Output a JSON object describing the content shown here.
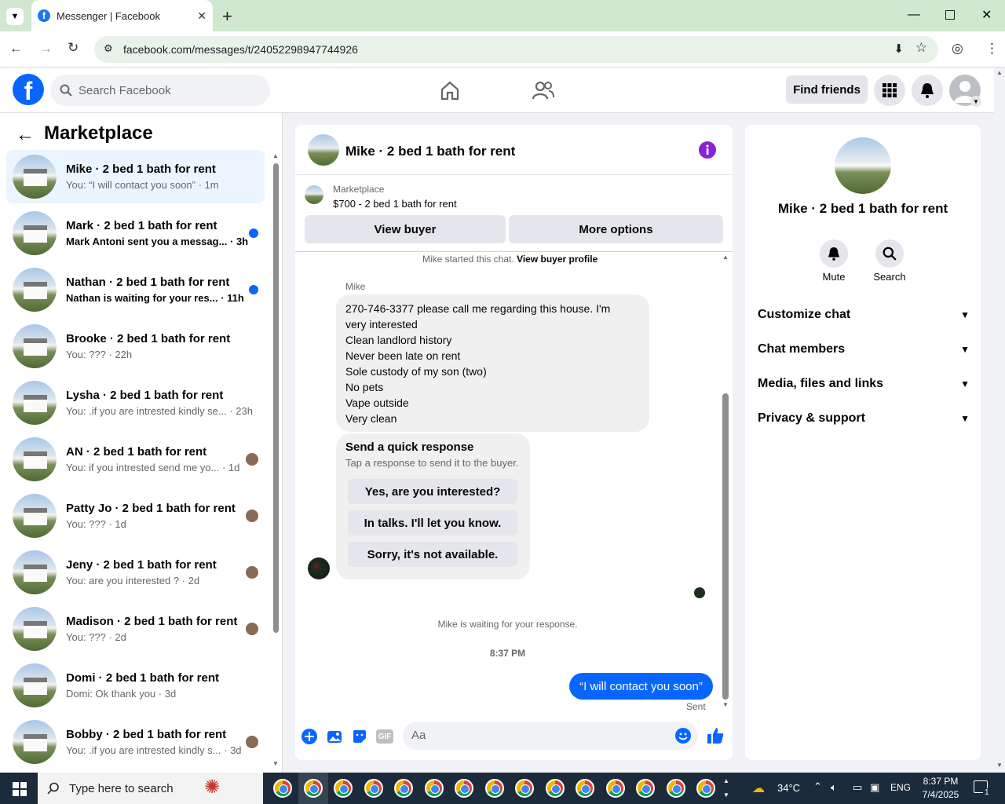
{
  "browser": {
    "tab_title": "Messenger | Facebook",
    "url": "facebook.com/messages/t/24052298947744926"
  },
  "fb": {
    "search_placeholder": "Search Facebook",
    "find_friends": "Find friends"
  },
  "left": {
    "title": "Marketplace",
    "conversations": [
      {
        "name": "Mike · 2 bed 1 bath for rent",
        "preview": "You: “I will contact you soon” · 1m",
        "indicator": "none"
      },
      {
        "name": "Mark · 2 bed 1 bath for rent",
        "preview": "Mark Antoni sent you a messag... · 3h",
        "indicator": "unread"
      },
      {
        "name": "Nathan · 2 bed 1 bath for rent",
        "preview": "Nathan is waiting for your res... · 11h",
        "indicator": "unread"
      },
      {
        "name": "Brooke · 2 bed 1 bath for rent",
        "preview": "You: ??? · 22h",
        "indicator": "none"
      },
      {
        "name": "Lysha · 2 bed 1 bath for rent",
        "preview": "You: .if you are intrested kindly se... · 23h",
        "indicator": "none"
      },
      {
        "name": "AN · 2 bed 1 bath for rent",
        "preview": "You: if you intrested send me yo... · 1d",
        "indicator": "avatar"
      },
      {
        "name": "Patty Jo · 2 bed 1 bath for rent",
        "preview": "You: ??? · 1d",
        "indicator": "avatar"
      },
      {
        "name": "Jeny · 2 bed 1 bath for rent",
        "preview": "You: are you interested ? · 2d",
        "indicator": "avatar"
      },
      {
        "name": "Madison · 2 bed 1 bath for rent",
        "preview": "You: ??? · 2d",
        "indicator": "avatar"
      },
      {
        "name": "Domi · 2 bed 1 bath for rent",
        "preview": "Domi: Ok thank you · 3d",
        "indicator": "none"
      },
      {
        "name": "Bobby · 2 bed 1 bath for rent",
        "preview": "You: .if you are intrested kindly s... · 3d",
        "indicator": "avatar"
      }
    ]
  },
  "chat": {
    "title": "Mike · 2 bed 1 bath for rent",
    "listing_source": "Marketplace",
    "listing_title": "$700 - 2 bed 1 bath for rent",
    "view_buyer": "View buyer",
    "more_options": "More options",
    "started_text": "Mike started this chat.",
    "view_buyer_profile": "View buyer profile",
    "sender_name": "Mike",
    "message_lines": [
      "270-746-3377 please call me regarding this house. I'm",
      "very interested",
      "Clean landlord history",
      "Never been late on rent",
      "Sole custody of my son (two)",
      "No pets",
      "Vape outside",
      "Very clean"
    ],
    "quick_title": "Send a quick response",
    "quick_sub": "Tap a response to send it to the buyer.",
    "quick_options": [
      "Yes, are you interested?",
      "In talks. I'll let you know.",
      "Sorry, it's not available."
    ],
    "waiting_text": "Mike is waiting for your response.",
    "time": "8:37 PM",
    "my_message": "“I will contact you soon”",
    "sent_status": "Sent",
    "composer_placeholder": "Aa",
    "gif_label": "GIF"
  },
  "right": {
    "name": "Mike · 2 bed 1 bath for rent",
    "mute": "Mute",
    "search": "Search",
    "sections": [
      "Customize chat",
      "Chat members",
      "Media, files and links",
      "Privacy & support"
    ]
  },
  "taskbar": {
    "search_placeholder": "Type here to search",
    "temperature": "34°C",
    "language": "ENG",
    "time": "8:37 PM",
    "date": "7/4/2025",
    "notif_count": "1"
  },
  "colors": {
    "accent": "#0866ff",
    "purple": "#8a23d6"
  }
}
